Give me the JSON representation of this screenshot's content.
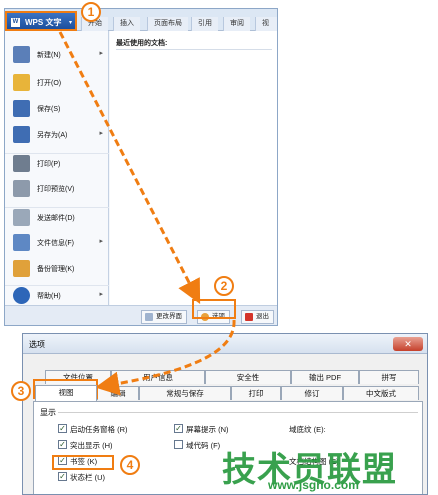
{
  "wps_menu": {
    "app_button": "WPS 文字",
    "app_button_arrow": "▾",
    "tabs": [
      "开始",
      "插入",
      "页面布局",
      "引用",
      "审阅",
      "视图"
    ],
    "items": [
      {
        "label": "新建(N)",
        "submenu": true,
        "icon": "new-document-icon",
        "color": "#5b7fb8"
      },
      {
        "label": "打开(O)",
        "submenu": false,
        "icon": "open-folder-icon",
        "color": "#e8b43a"
      },
      {
        "label": "保存(S)",
        "submenu": false,
        "icon": "save-icon",
        "color": "#3f6db3"
      },
      {
        "label": "另存为(A)",
        "submenu": true,
        "icon": "save-as-icon",
        "color": "#3f6db3"
      },
      {
        "label": "打印(P)",
        "submenu": false,
        "icon": "print-icon",
        "color": "#6f7d8f"
      },
      {
        "label": "打印预览(V)",
        "submenu": false,
        "icon": "print-preview-icon",
        "color": "#8d9aab"
      },
      {
        "label": "发送邮件(D)",
        "submenu": false,
        "icon": "mail-icon",
        "color": "#9aa8b9"
      },
      {
        "label": "文件信息(F)",
        "submenu": true,
        "icon": "file-info-icon",
        "color": "#5e88c4"
      },
      {
        "label": "备份管理(K)",
        "submenu": false,
        "icon": "backup-icon",
        "color": "#e0a13a"
      },
      {
        "label": "帮助(H)",
        "submenu": true,
        "icon": "help-icon",
        "color": "#2d66b8"
      }
    ],
    "recent_title": "最近使用的文档:",
    "footer": {
      "change_ui": "更改界面",
      "options": "选项",
      "exit": "退出"
    }
  },
  "dialog": {
    "title": "选项",
    "close": "✕",
    "tabs_row1": [
      "文件位置",
      "用户信息",
      "安全性",
      "输出 PDF",
      "拼写"
    ],
    "tabs_row2": [
      "视图",
      "编辑",
      "常规与保存",
      "打印",
      "修订",
      "中文版式"
    ],
    "active_tab": "视图",
    "section": "显示",
    "options": [
      {
        "label": "启动任务窗格 (R)",
        "checked": true
      },
      {
        "label": "突出显示 (H)",
        "checked": true
      },
      {
        "label": "书签 (K)",
        "checked": true
      },
      {
        "label": "状态栏 (U)",
        "checked": true
      },
      {
        "label": "屏幕提示 (N)",
        "checked": true
      },
      {
        "label": "域代码 (F)",
        "checked": false
      }
    ],
    "right_labels": [
      "域底纹 (E):",
      "文档结构图 (E):"
    ]
  },
  "steps": [
    "1",
    "2",
    "3",
    "4"
  ],
  "check_mark": "✓",
  "watermark": {
    "main": "技术员联盟",
    "url": "www.jsgho.com"
  },
  "colors": {
    "highlight": "#f07d12",
    "watermark": "#2f9d45",
    "wps_blue": "#1c4f9c"
  }
}
